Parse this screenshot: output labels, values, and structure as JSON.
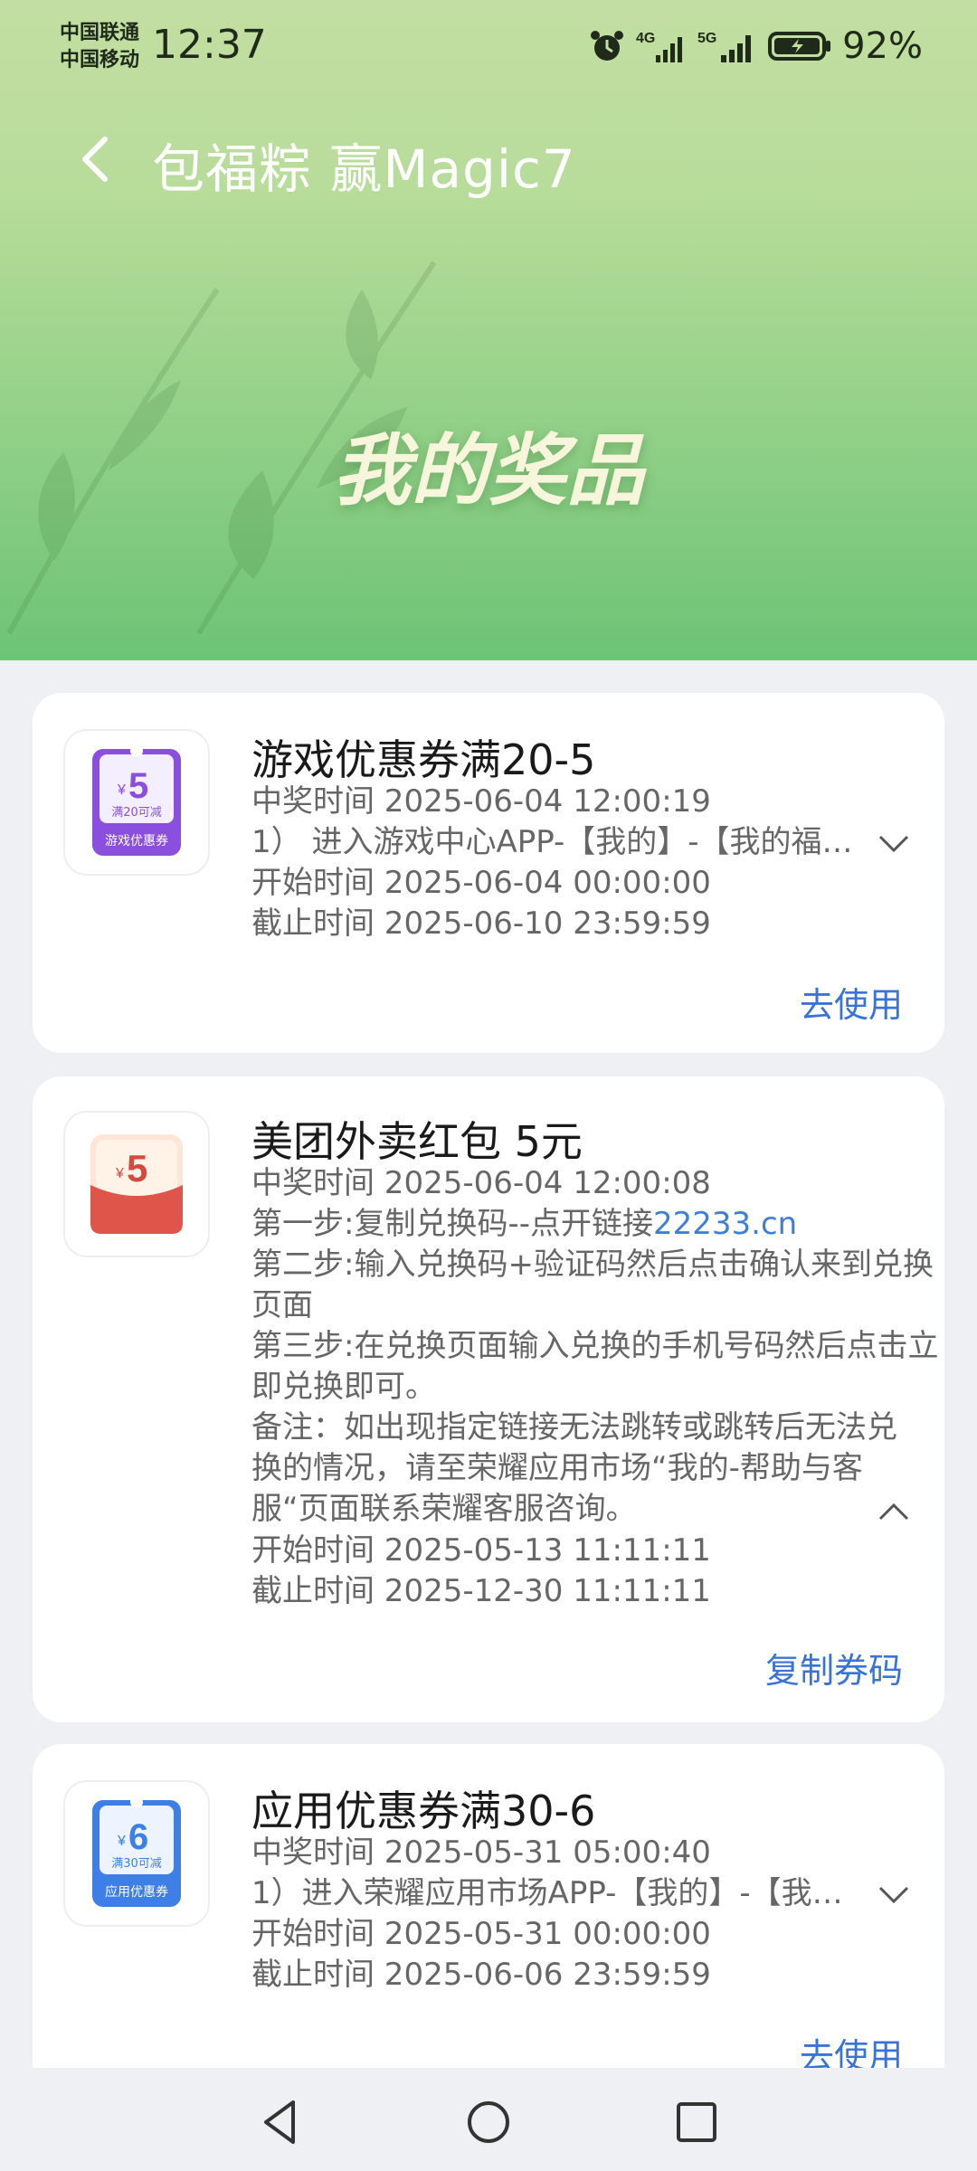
{
  "status_bar": {
    "carrier_1": "中国联通",
    "carrier_2": "中国移动",
    "time": "12:37",
    "battery": "92%",
    "icons": [
      "alarm-icon",
      "signal-4g-icon",
      "signal-5g-icon",
      "battery-charging-icon"
    ]
  },
  "header": {
    "title": "包福粽 赢Magic7",
    "banner_title": "我的奖品"
  },
  "prizes": [
    {
      "title": "游戏优惠券满20-5",
      "win_time": "中奖时间  2025-06-04 12:00:19",
      "instruction": "1）  进入游戏中心APP-【我的】-【我的福…",
      "start_time": "开始时间  2025-06-04 00:00:00",
      "end_time": "截止时间  2025-06-10 23:59:59",
      "action": "去使用",
      "coupon": {
        "amount": "5",
        "currency": "¥",
        "condition": "满20可减",
        "label": "游戏优惠券",
        "color": "#8b4fe0"
      }
    },
    {
      "title": "美团外卖红包 5元",
      "win_time": "中奖时间  2025-06-04 12:00:08",
      "step1": "第一步:复制兑换码--点开链接",
      "step1_link": "22233.cn",
      "step2": "第二步:输入兑换码+验证码然后点击确认来到兑换页面",
      "step3": "第三步:在兑换页面输入兑换的手机号码然后点击立即兑换即可。",
      "note": "备注：如出现指定链接无法跳转或跳转后无法兑换的情况，请至荣耀应用市场“我的-帮助与客服“页面联系荣耀客服咨询。",
      "start_time": "开始时间  2025-05-13 11:11:11",
      "end_time": "截止时间  2025-12-30 11:11:11",
      "action": "复制券码",
      "coupon": {
        "amount": "5",
        "currency": "¥",
        "color": "#e0554a"
      }
    },
    {
      "title": "应用优惠券满30-6",
      "win_time": "中奖时间  2025-05-31 05:00:40",
      "instruction": "1）进入荣耀应用市场APP-【我的】-【我…",
      "start_time": "开始时间  2025-05-31 00:00:00",
      "end_time": "截止时间  2025-06-06 23:59:59",
      "action": "去使用",
      "coupon": {
        "amount": "6",
        "currency": "¥",
        "condition": "满30可减",
        "label": "应用优惠券",
        "color": "#3d7fe6"
      }
    }
  ],
  "nav": [
    "back-triangle-icon",
    "home-circle-icon",
    "recents-square-icon"
  ]
}
